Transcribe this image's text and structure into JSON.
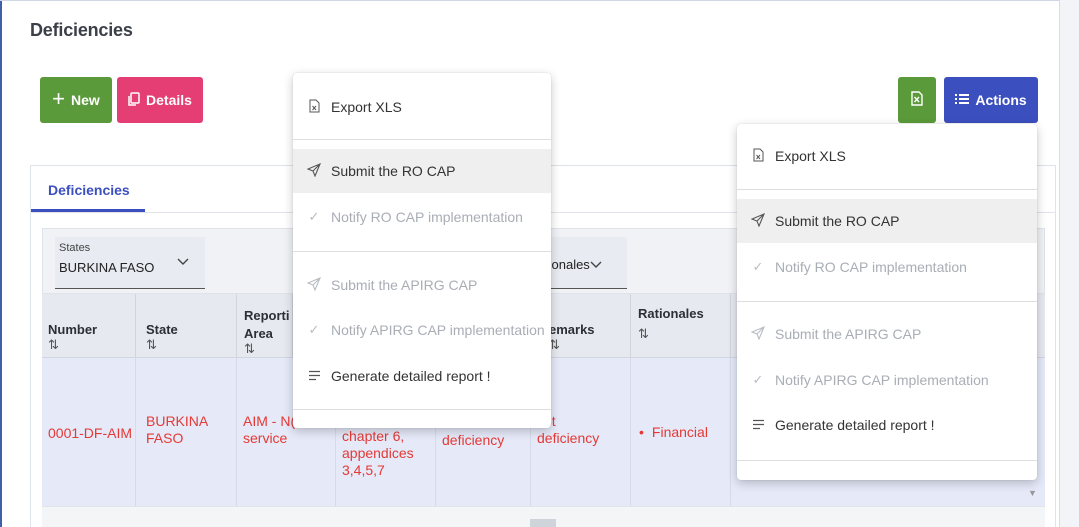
{
  "page": {
    "title": "Deficiencies"
  },
  "toolbar": {
    "new_label": "New",
    "details_label": "Details",
    "actions_label": "Actions"
  },
  "tabs": [
    {
      "label": "Deficiencies",
      "active": true
    }
  ],
  "filters": {
    "states": {
      "label": "States",
      "value": "BURKINA FASO"
    },
    "rationales": {
      "value": "tionales"
    }
  },
  "table": {
    "headers": {
      "number": "Number",
      "state": "State",
      "reporting_area_line1": "Reporti",
      "reporting_area_line2": "Area",
      "remarks": "emarks",
      "rationales": "Rationales",
      "sort_glyph": "⇅"
    },
    "rows": [
      {
        "number": "0001-DF-AIM",
        "state_line1": "BURKINA",
        "state_line2": "FASO",
        "reporting_area_line1": "AIM - N(",
        "reporting_area_line2": "service",
        "reference_line1": "chapter 6,",
        "reference_line2": "appendices",
        "reference_line3": "3,4,5,7",
        "description": "deficiency",
        "remarks_line1": "est",
        "remarks_line2": "deficiency",
        "rationales_item": "Financial"
      }
    ]
  },
  "menu_export": {
    "items": [
      {
        "label": "Export XLS",
        "icon": "file-icon",
        "disabled": false
      },
      {
        "label": "Submit the RO CAP",
        "icon": "send-icon",
        "disabled": false,
        "hover": true
      },
      {
        "label": "Notify RO CAP implementation",
        "icon": "check-icon",
        "disabled": true
      },
      {
        "label": "Submit the APIRG CAP",
        "icon": "send-icon",
        "disabled": true
      },
      {
        "label": "Notify APIRG CAP implementation",
        "icon": "check-icon",
        "disabled": true
      },
      {
        "label": "Generate detailed report !",
        "icon": "list-icon",
        "disabled": false
      }
    ]
  },
  "menu_actions": {
    "items": [
      {
        "label": "Export XLS",
        "icon": "file-icon",
        "disabled": false
      },
      {
        "label": "Submit the RO CAP",
        "icon": "send-icon",
        "disabled": false,
        "hover": true
      },
      {
        "label": "Notify RO CAP implementation",
        "icon": "check-icon",
        "disabled": true
      },
      {
        "label": "Submit the APIRG CAP",
        "icon": "send-icon",
        "disabled": true
      },
      {
        "label": "Notify APIRG CAP implementation",
        "icon": "check-icon",
        "disabled": true
      },
      {
        "label": "Generate detailed report !",
        "icon": "list-icon",
        "disabled": false
      }
    ]
  },
  "colors": {
    "primary": "#3c4fbe",
    "success": "#5b9a3a",
    "pink": "#e53e74",
    "danger_text": "#e53935"
  }
}
